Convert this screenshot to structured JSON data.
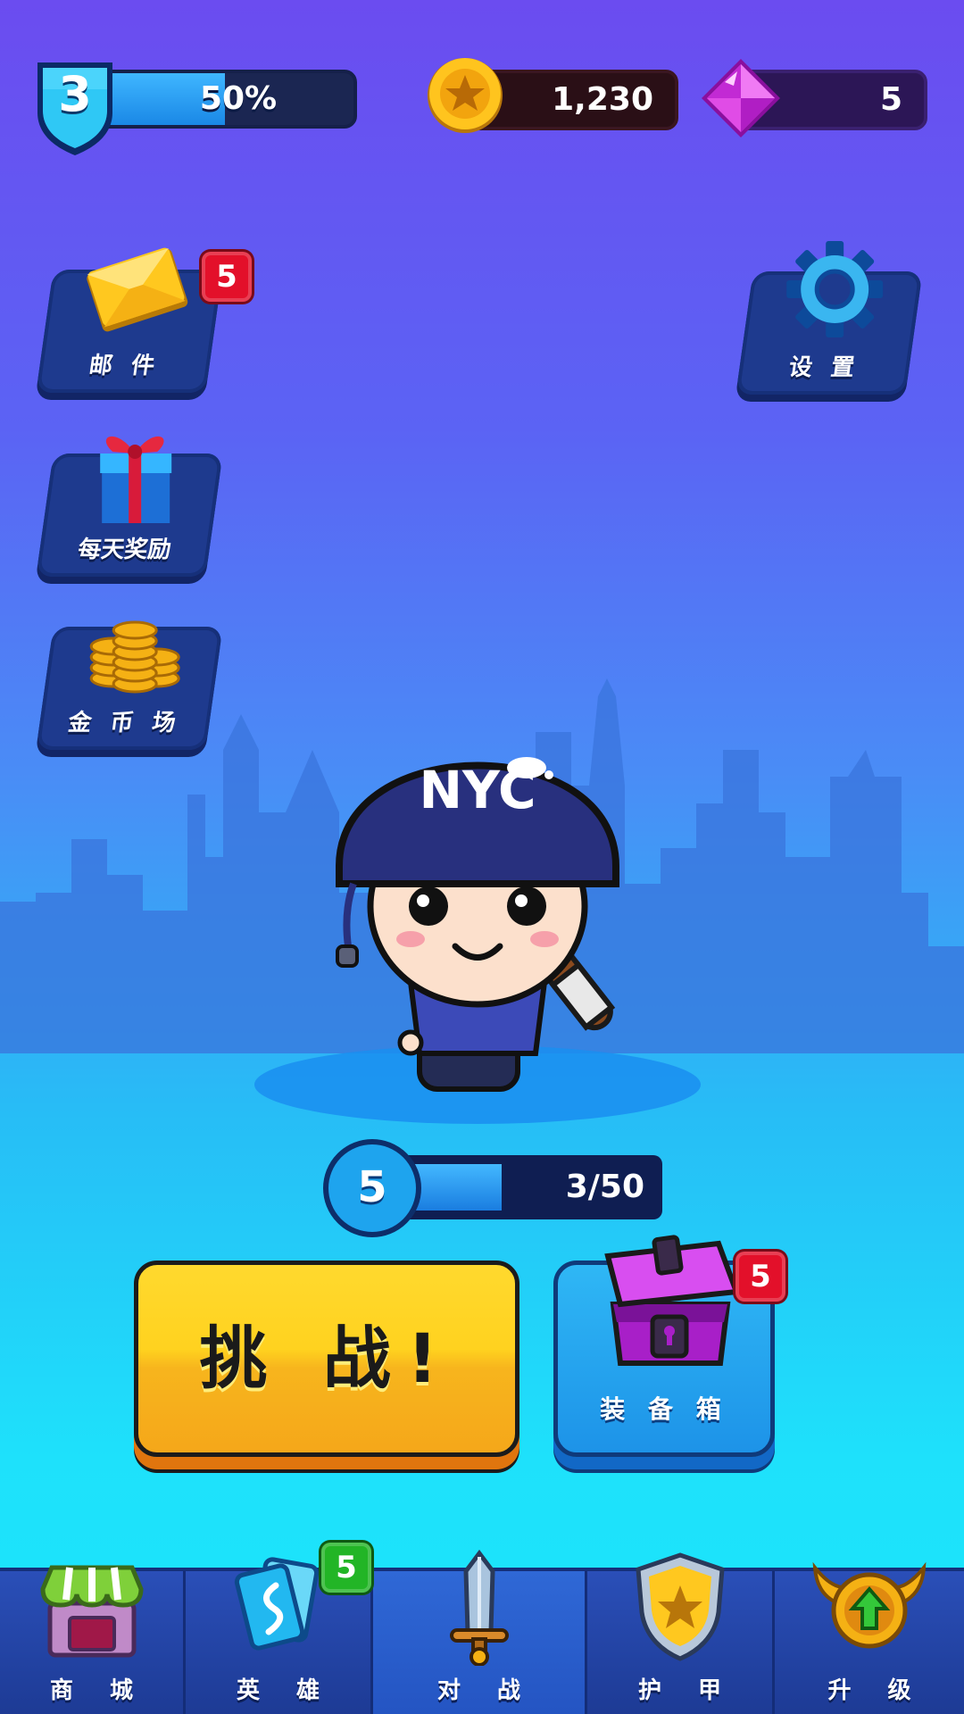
{
  "player": {
    "level": "3",
    "xp_percent_text": "50%",
    "xp_fraction": 0.5
  },
  "currency": {
    "coins": "1,230",
    "gems": "5"
  },
  "side_buttons": {
    "mail": {
      "label": "邮 件",
      "badge": "5",
      "icon": "mail-envelope-icon"
    },
    "daily": {
      "label": "每天奖励",
      "icon": "gift-box-icon"
    },
    "coin_arena": {
      "label": "金 币 场",
      "icon": "coin-stack-icon"
    },
    "settings": {
      "label": "设 置",
      "icon": "gear-icon"
    }
  },
  "character": {
    "helmet_text": "NYC",
    "level": "5",
    "progress_text": "3/50",
    "progress_fraction": 0.06
  },
  "actions": {
    "challenge_label": "挑 战!",
    "chest_label": "装 备 箱",
    "chest_badge": "5"
  },
  "nav": [
    {
      "label": "商 城",
      "icon": "shop-icon"
    },
    {
      "label": "英 雄",
      "icon": "hero-cards-icon",
      "badge": "5"
    },
    {
      "label": "对 战",
      "icon": "sword-icon"
    },
    {
      "label": "护 甲",
      "icon": "shield-icon"
    },
    {
      "label": "升 级",
      "icon": "upgrade-icon"
    }
  ],
  "colors": {
    "background_top": "#6b4cf0",
    "background_bottom": "#1ae6fb",
    "challenge_yellow": "#ffd21f",
    "badge_red": "#e3102a",
    "badge_green": "#22b526"
  }
}
